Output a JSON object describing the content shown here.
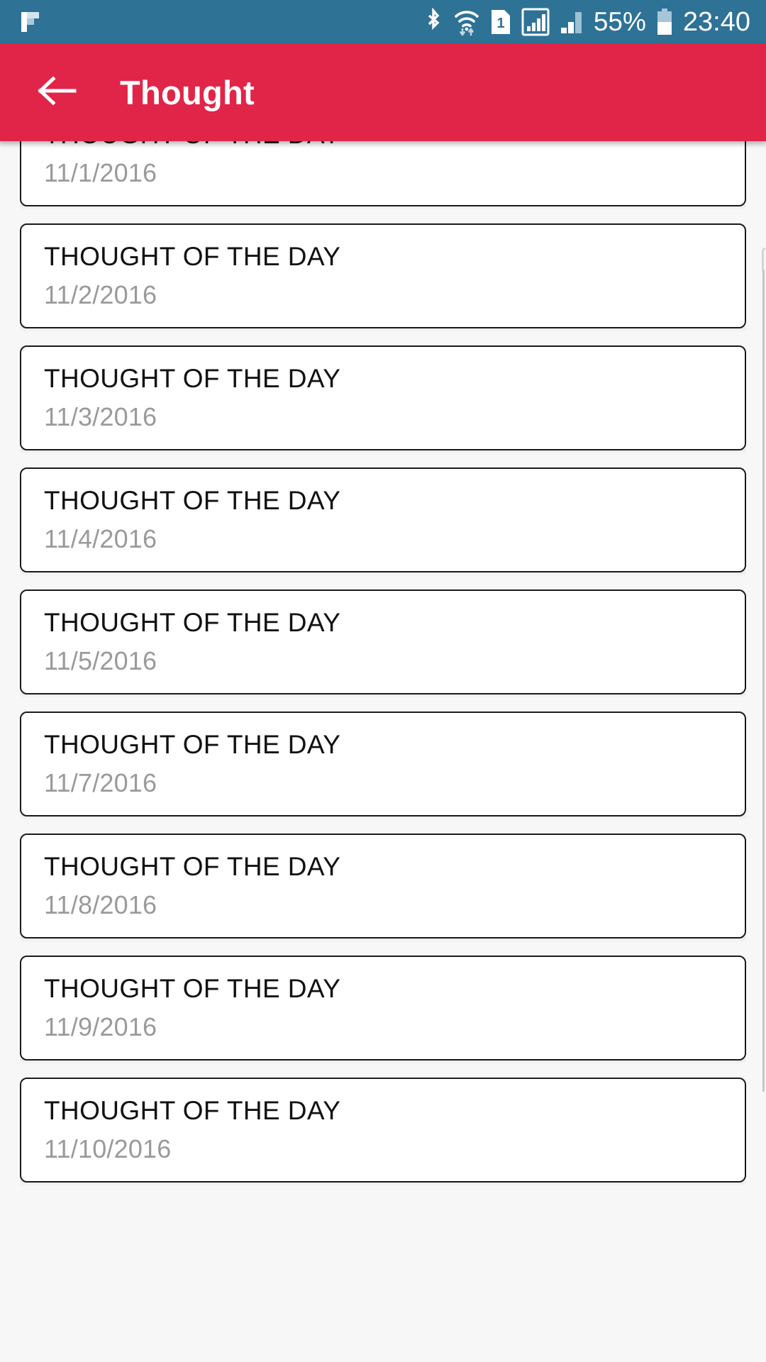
{
  "status_bar": {
    "background": "#2e7296",
    "notification_icon": "flipboard-icon",
    "icons": [
      "bluetooth-icon",
      "wifi-icon",
      "sim-card-1-icon",
      "signal-boxed-icon",
      "signal-bars-icon"
    ],
    "battery_percent": "55%",
    "battery_level": 55,
    "clock": "23:40"
  },
  "app_bar": {
    "background": "#e12548",
    "back_icon": "arrow-left-icon",
    "title": "Thought"
  },
  "list": {
    "background": "#f7f7f7",
    "items": [
      {
        "title": "THOUGHT OF THE DAY",
        "date": "11/1/2016"
      },
      {
        "title": "THOUGHT OF THE DAY",
        "date": "11/2/2016"
      },
      {
        "title": "THOUGHT OF THE DAY",
        "date": "11/3/2016"
      },
      {
        "title": "THOUGHT OF THE DAY",
        "date": "11/4/2016"
      },
      {
        "title": "THOUGHT OF THE DAY",
        "date": "11/5/2016"
      },
      {
        "title": "THOUGHT OF THE DAY",
        "date": "11/7/2016"
      },
      {
        "title": "THOUGHT OF THE DAY",
        "date": "11/8/2016"
      },
      {
        "title": "THOUGHT OF THE DAY",
        "date": "11/9/2016"
      },
      {
        "title": "THOUGHT OF THE DAY",
        "date": "11/10/2016"
      }
    ]
  }
}
